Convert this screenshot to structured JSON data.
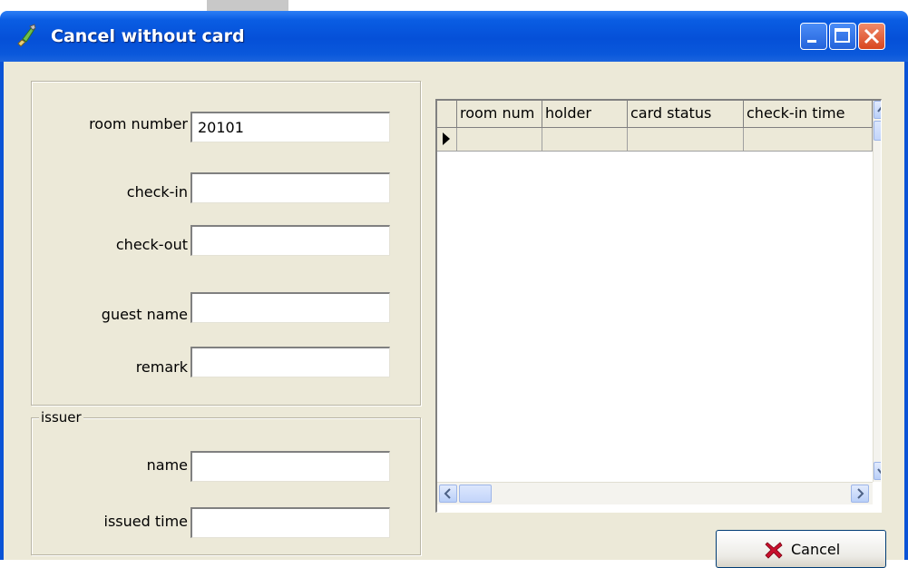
{
  "window": {
    "title": "Cancel without card"
  },
  "form": {
    "room_number_label": "room number",
    "room_number_value": "20101",
    "checkin_label": "check-in",
    "checkin_value": "",
    "checkout_label": "check-out",
    "checkout_value": "",
    "guest_name_label": "guest name",
    "guest_name_value": "",
    "remark_label": "remark",
    "remark_value": ""
  },
  "issuer": {
    "caption": "issuer",
    "name_label": "name",
    "name_value": "",
    "issued_time_label": "issued time",
    "issued_time_value": ""
  },
  "grid": {
    "columns": [
      "room num",
      "holder",
      "card status",
      "check-in time"
    ]
  },
  "actions": {
    "cancel_label": "Cancel"
  },
  "icons": {
    "app": "brush-icon",
    "cancel": "red-x-icon"
  },
  "colors": {
    "titlebar": "#0550d8",
    "client_bg": "#ece9d8",
    "close_button": "#d8461f"
  }
}
